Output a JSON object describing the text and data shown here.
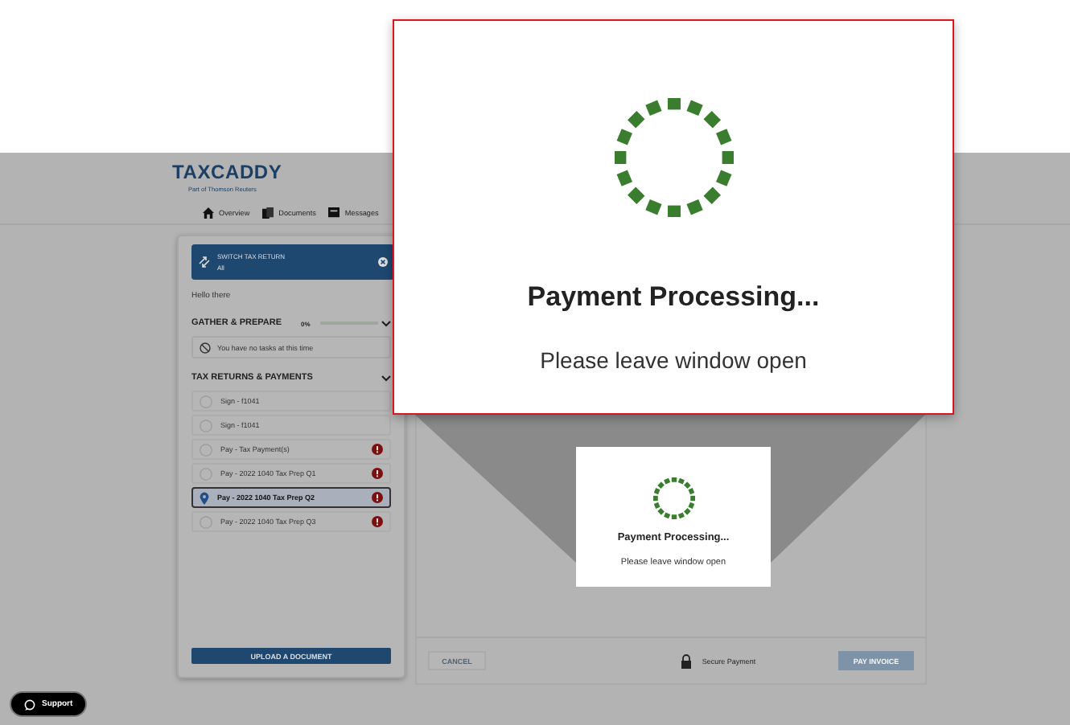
{
  "header": {
    "logo": "TAXCADDY",
    "tagline": "Part of Thomson Reuters",
    "nav": [
      {
        "label": "Overview"
      },
      {
        "label": "Documents"
      },
      {
        "label": "Messages"
      }
    ]
  },
  "sidebar": {
    "switch": {
      "title": "SWITCH TAX RETURN",
      "value": "All"
    },
    "greeting": "Hello there",
    "gather": {
      "title": "GATHER & PREPARE",
      "percent": "0%",
      "level": 0,
      "empty": "You have no tasks at this time"
    },
    "payments": {
      "title": "TAX RETURNS & PAYMENTS",
      "items": [
        {
          "label": "Sign - f1041",
          "selected": false,
          "alert": false
        },
        {
          "label": "Sign - f1041",
          "selected": false,
          "alert": false
        },
        {
          "label": "Pay - Tax Payment(s)",
          "selected": false,
          "alert": true
        },
        {
          "label": "Pay - 2022 1040 Tax Prep Q1",
          "selected": false,
          "alert": true
        },
        {
          "label": "Pay - 2022 1040 Tax Prep Q2",
          "selected": true,
          "alert": true
        },
        {
          "label": "Pay - 2022 1040 Tax Prep Q3",
          "selected": false,
          "alert": true
        }
      ]
    },
    "upload": "UPLOAD A DOCUMENT"
  },
  "payment_panel": {
    "cancel": "CANCEL",
    "secure": "Secure Payment",
    "pay": "PAY INVOICE",
    "pay_disabled": true
  },
  "processing_dialog": {
    "title": "Payment Processing...",
    "message": "Please leave window open"
  },
  "zoomed_dialog": {
    "title": "Payment Processing...",
    "message": "Please leave window open"
  },
  "support": "Support"
}
